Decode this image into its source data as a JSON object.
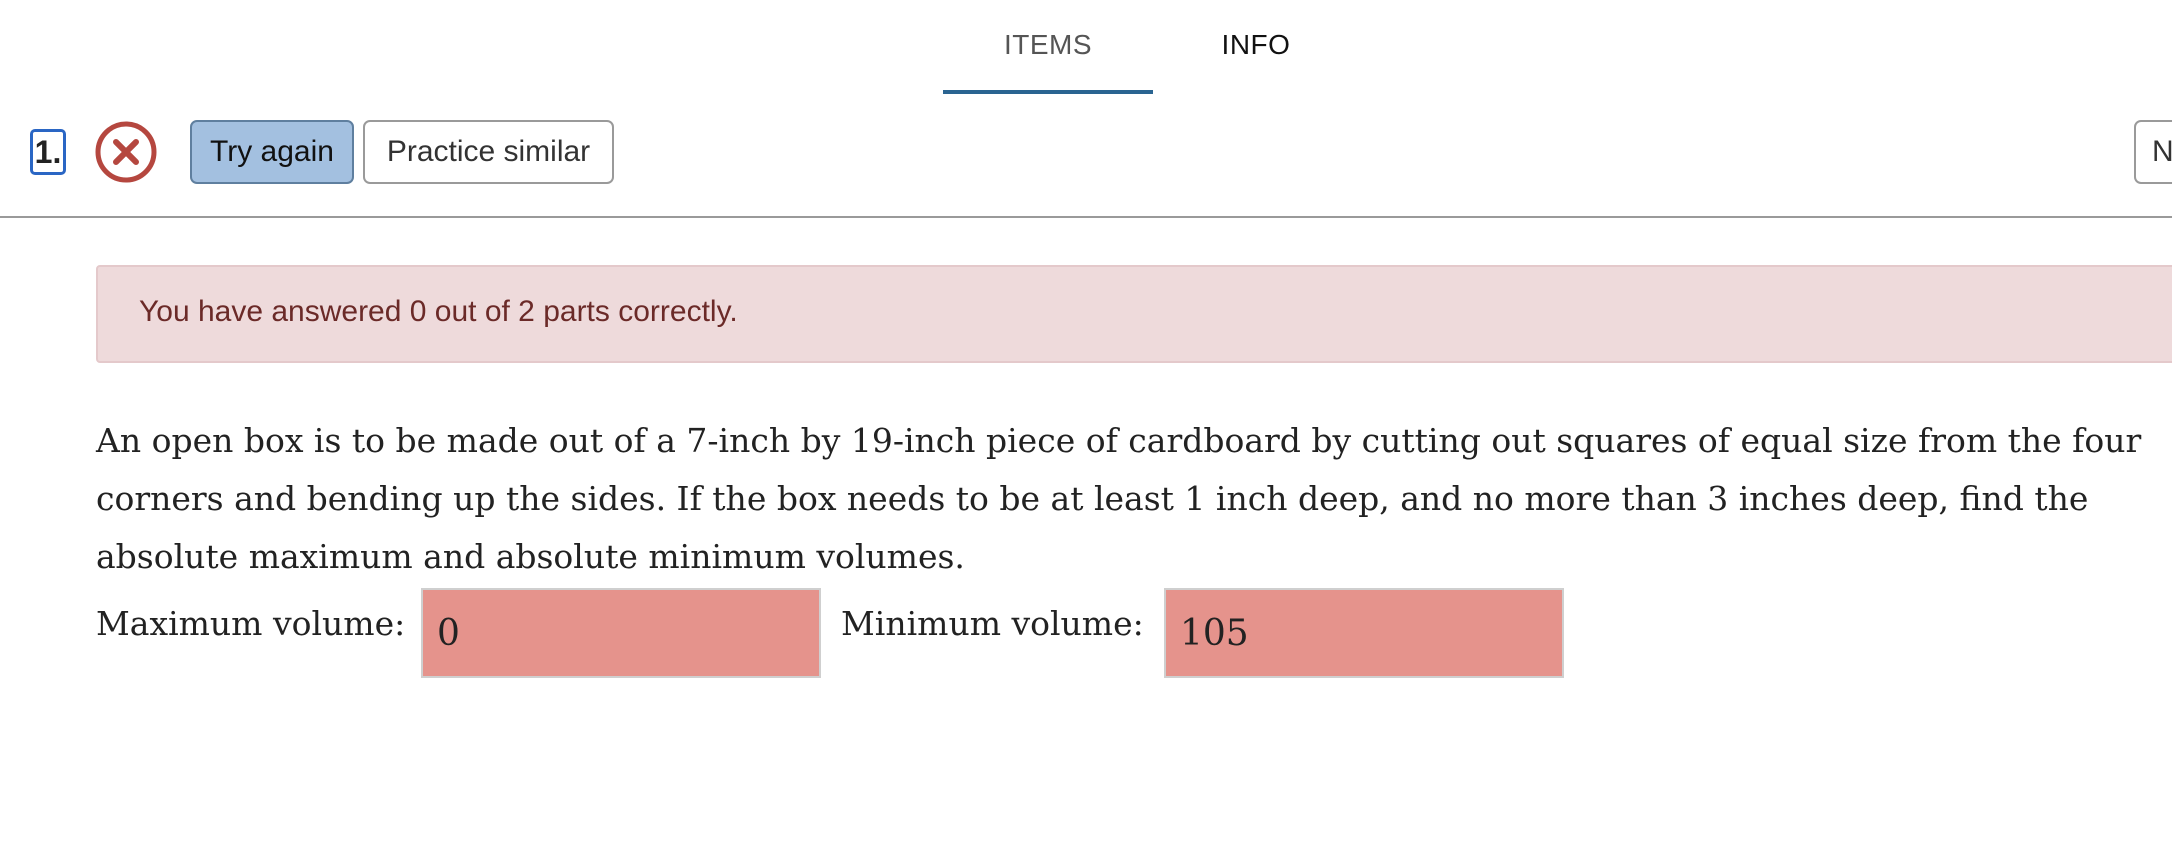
{
  "tabs": [
    {
      "label": "ITEMS"
    },
    {
      "label": "INFO"
    }
  ],
  "toolbar": {
    "question_number": "1.",
    "status_icon": "incorrect-x-circle-icon",
    "try_again_label": "Try again",
    "practice_similar_label": "Practice similar",
    "next_label": "N"
  },
  "alert": {
    "text": "You have answered 0 out of 2 parts correctly."
  },
  "problem": {
    "text": "An open box is to be made out of a 7-inch by 19-inch piece of cardboard by cutting out squares of equal size from the four corners and bending up the sides. If the box needs to be at least 1 inch deep, and no more than 3 inches deep, find the absolute maximum and absolute minimum volumes.",
    "max_label": "Maximum volume:",
    "max_value": "0",
    "min_label": "Minimum volume:",
    "min_value": "105"
  },
  "colors": {
    "accent": "#2a6491",
    "incorrect": "#b5473f",
    "alert_bg": "#eedadb",
    "answer_incorrect_bg": "#e5938c"
  }
}
